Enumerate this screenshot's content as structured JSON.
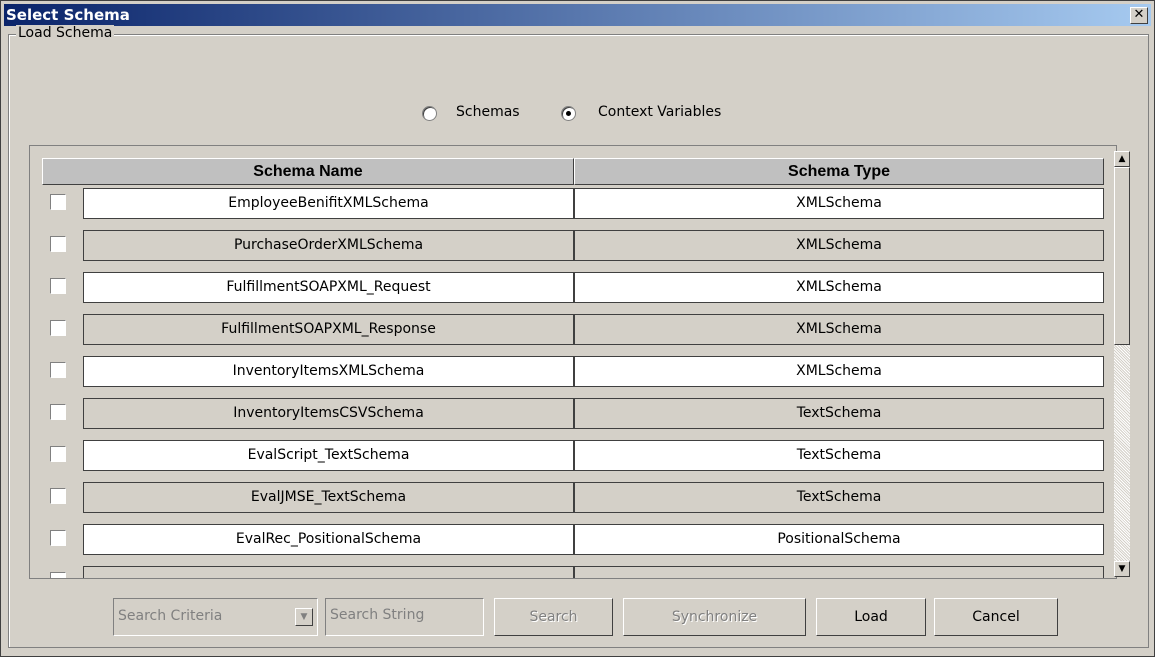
{
  "window": {
    "title": "Select Schema",
    "close_icon": "close-icon"
  },
  "group": {
    "label": "Load Schema"
  },
  "radio": {
    "schemas_label": "Schemas",
    "schemas_selected": false,
    "context_label": "Context Variables",
    "context_selected": true
  },
  "table": {
    "columns": [
      "Schema Name",
      "Schema Type"
    ],
    "rows": [
      {
        "name": "EmployeeBenifitXMLSchema",
        "type": "XMLSchema",
        "checked": false
      },
      {
        "name": "PurchaseOrderXMLSchema",
        "type": "XMLSchema",
        "checked": false
      },
      {
        "name": "FulfillmentSOAPXML_Request",
        "type": "XMLSchema",
        "checked": false
      },
      {
        "name": "FulfillmentSOAPXML_Response",
        "type": "XMLSchema",
        "checked": false
      },
      {
        "name": "InventoryItemsXMLSchema",
        "type": "XMLSchema",
        "checked": false
      },
      {
        "name": "InventoryItemsCSVSchema",
        "type": "TextSchema",
        "checked": false
      },
      {
        "name": "EvalScript_TextSchema",
        "type": "TextSchema",
        "checked": false
      },
      {
        "name": "EvalJMSE_TextSchema",
        "type": "TextSchema",
        "checked": false
      },
      {
        "name": "EvalRec_PositionalSchema",
        "type": "PositionalSchema",
        "checked": false
      },
      {
        "name": "",
        "type": "",
        "checked": false
      }
    ]
  },
  "bottom": {
    "search_criteria": "Search Criteria",
    "search_string": "Search String",
    "search_label": "Search",
    "synchronize_label": "Synchronize",
    "load_label": "Load",
    "cancel_label": "Cancel"
  }
}
